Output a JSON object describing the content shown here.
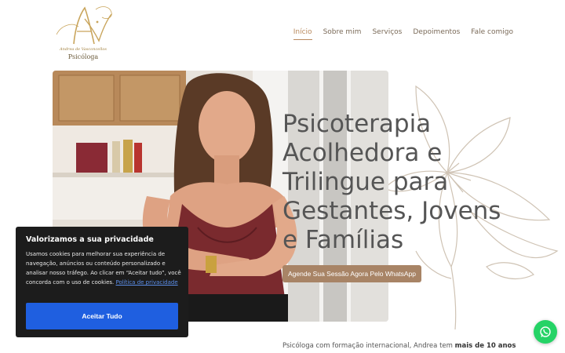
{
  "header": {
    "logo": {
      "script_name": "Andrea de Vasconcellos",
      "role": "Psicóloga",
      "monogram": "AV"
    },
    "nav": [
      {
        "label": "Início",
        "active": true
      },
      {
        "label": "Sobre mim"
      },
      {
        "label": "Serviços"
      },
      {
        "label": "Depoimentos"
      },
      {
        "label": "Fale comigo"
      }
    ]
  },
  "hero": {
    "headline": "Psicoterapia Acolhedora e Trilingue para Gestantes, Jovens e Famílias",
    "cta_label": "Agende Sua Sessão Agora Pelo WhatsApp",
    "intro_prefix": "Psicóloga com formação internacional, Andrea tem ",
    "intro_bold": "mais de 10 anos"
  },
  "cookie_banner": {
    "title": "Valorizamos a sua privacidade",
    "text": "Usamos cookies para melhorar sua experiência de navegação, anúncios ou conteúdo personalizado e analisar nosso tráfego. Ao clicar em “Aceitar tudo”, você concorda com o uso de cookies.",
    "link_label": "Política de privacidade",
    "accept_label": "Aceitar Tudo"
  },
  "floating": {
    "icon": "whatsapp-icon"
  },
  "colors": {
    "accent": "#b98a5e",
    "cta": "#a88466",
    "cookie_bg": "#1c1c1c",
    "cookie_button": "#1f5fe0",
    "whatsapp": "#25d366",
    "logo_gold": "#c9a55c"
  }
}
